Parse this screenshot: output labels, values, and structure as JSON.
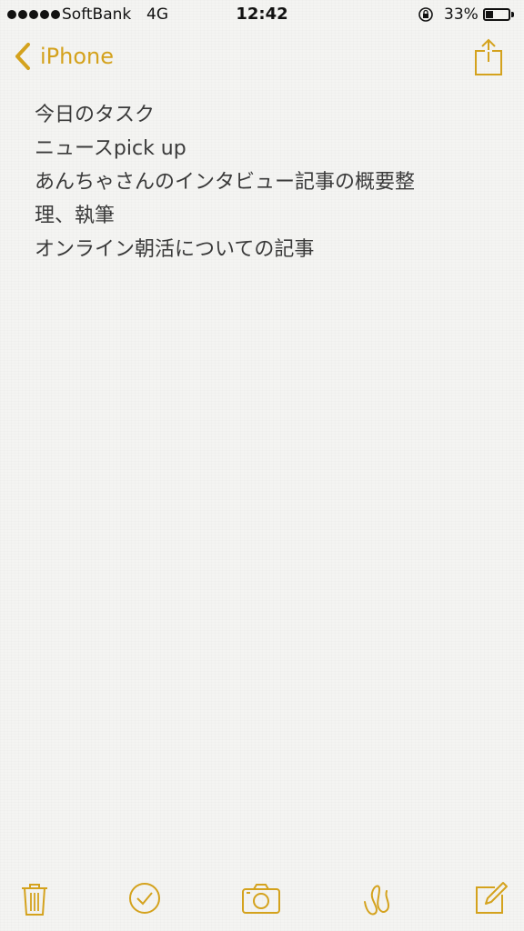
{
  "status_bar": {
    "carrier": "SoftBank",
    "network": "4G",
    "time": "12:42",
    "battery_percent": "33%",
    "battery_level": 0.33
  },
  "nav": {
    "back_label": "iPhone",
    "accent_color": "#d4a21d"
  },
  "note": {
    "lines": [
      "今日のタスク",
      "ニュースpick up",
      "あんちゃさんのインタビュー記事の概要整",
      "理、執筆",
      "オンライン朝活についての記事"
    ]
  },
  "toolbar": {
    "icons": [
      "trash-icon",
      "checkmark-icon",
      "camera-icon",
      "sketch-icon",
      "compose-icon"
    ]
  }
}
